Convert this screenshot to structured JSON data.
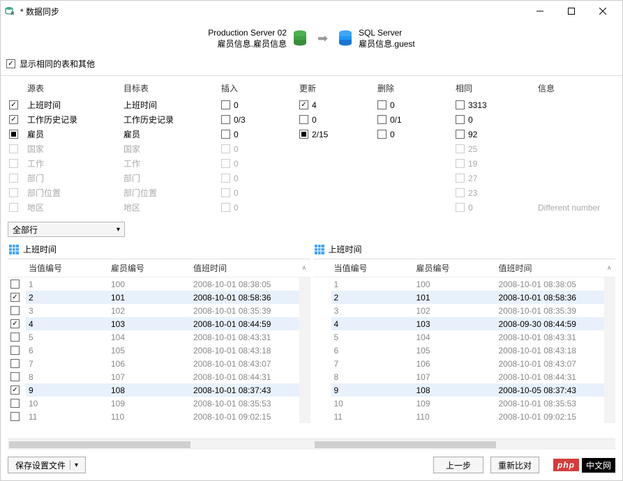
{
  "window": {
    "title": "* 数据同步"
  },
  "connection": {
    "source": {
      "server": "Production Server 02",
      "db": "雇员信息.雇员信息"
    },
    "target": {
      "server": "SQL Server",
      "db": "雇员信息.guest"
    }
  },
  "options": {
    "show_identical": "显示相同的表和其他"
  },
  "tables": {
    "headers": {
      "source": "源表",
      "target": "目标表",
      "insert": "插入",
      "update": "更新",
      "delete": "删除",
      "same": "相同",
      "info": "信息"
    },
    "rows": [
      {
        "check": "checked",
        "src": "上班时间",
        "tgt": "上班时间",
        "ins": "0",
        "upd": "4",
        "upd_check": "checked",
        "del": "0",
        "same": "3313",
        "info": "",
        "dis": false
      },
      {
        "check": "checked",
        "src": "工作历史记录",
        "tgt": "工作历史记录",
        "ins": "0/3",
        "upd": "0",
        "del": "0/1",
        "same": "0",
        "info": "",
        "dis": false
      },
      {
        "check": "partial",
        "src": "雇员",
        "tgt": "雇员",
        "ins": "0",
        "upd": "2/15",
        "upd_check": "partial",
        "del": "0",
        "same": "92",
        "info": "",
        "dis": false
      },
      {
        "check": "",
        "src": "国家",
        "tgt": "国家",
        "ins": "0",
        "upd": "",
        "del": "",
        "same": "25",
        "info": "",
        "dis": true
      },
      {
        "check": "",
        "src": "工作",
        "tgt": "工作",
        "ins": "0",
        "upd": "",
        "del": "",
        "same": "19",
        "info": "",
        "dis": true
      },
      {
        "check": "",
        "src": "部门",
        "tgt": "部门",
        "ins": "0",
        "upd": "",
        "del": "",
        "same": "27",
        "info": "",
        "dis": true
      },
      {
        "check": "",
        "src": "部门位置",
        "tgt": "部门位置",
        "ins": "0",
        "upd": "",
        "del": "",
        "same": "23",
        "info": "",
        "dis": true
      },
      {
        "check": "",
        "src": "地区",
        "tgt": "地区",
        "ins": "0",
        "upd": "",
        "del": "",
        "same": "0",
        "info": "Different number",
        "dis": true
      }
    ]
  },
  "filter": {
    "label": "全部行"
  },
  "panes": {
    "left": {
      "title": "上班时间",
      "columns": [
        "当值编号",
        "雇员编号",
        "值班时间"
      ],
      "rows": [
        {
          "c": "",
          "v": [
            "1",
            "100",
            "2008-10-01 08:38:05"
          ],
          "hl": false
        },
        {
          "c": "checked",
          "v": [
            "2",
            "101",
            "2008-10-01 08:58:36"
          ],
          "hl": true
        },
        {
          "c": "",
          "v": [
            "3",
            "102",
            "2008-10-01 08:35:39"
          ],
          "hl": false
        },
        {
          "c": "checked",
          "v": [
            "4",
            "103",
            "2008-10-01 08:44:59"
          ],
          "hl": true
        },
        {
          "c": "",
          "v": [
            "5",
            "104",
            "2008-10-01 08:43:31"
          ],
          "hl": false
        },
        {
          "c": "",
          "v": [
            "6",
            "105",
            "2008-10-01 08:43:18"
          ],
          "hl": false
        },
        {
          "c": "",
          "v": [
            "7",
            "106",
            "2008-10-01 08:43:07"
          ],
          "hl": false
        },
        {
          "c": "",
          "v": [
            "8",
            "107",
            "2008-10-01 08:44:31"
          ],
          "hl": false
        },
        {
          "c": "checked",
          "v": [
            "9",
            "108",
            "2008-10-01 08:37:43"
          ],
          "hl": true
        },
        {
          "c": "",
          "v": [
            "10",
            "109",
            "2008-10-01 08:35:53"
          ],
          "hl": false
        },
        {
          "c": "",
          "v": [
            "11",
            "110",
            "2008-10-01 09:02:15"
          ],
          "hl": false
        }
      ]
    },
    "right": {
      "title": "上班时间",
      "columns": [
        "当值编号",
        "雇员编号",
        "值班时间"
      ],
      "rows": [
        {
          "c": "",
          "v": [
            "1",
            "100",
            "2008-10-01 08:38:05"
          ],
          "hl": false
        },
        {
          "c": "",
          "v": [
            "2",
            "101",
            "2008-10-01 08:58:36"
          ],
          "hl": true
        },
        {
          "c": "",
          "v": [
            "3",
            "102",
            "2008-10-01 08:35:39"
          ],
          "hl": false
        },
        {
          "c": "",
          "v": [
            "4",
            "103",
            "2008-09-30 08:44:59"
          ],
          "hl": true
        },
        {
          "c": "",
          "v": [
            "5",
            "104",
            "2008-10-01 08:43:31"
          ],
          "hl": false
        },
        {
          "c": "",
          "v": [
            "6",
            "105",
            "2008-10-01 08:43:18"
          ],
          "hl": false
        },
        {
          "c": "",
          "v": [
            "7",
            "106",
            "2008-10-01 08:43:07"
          ],
          "hl": false
        },
        {
          "c": "",
          "v": [
            "8",
            "107",
            "2008-10-01 08:44:31"
          ],
          "hl": false
        },
        {
          "c": "",
          "v": [
            "9",
            "108",
            "2008-10-05 08:37:43"
          ],
          "hl": true
        },
        {
          "c": "",
          "v": [
            "10",
            "109",
            "2008-10-01 08:35:53"
          ],
          "hl": false
        },
        {
          "c": "",
          "v": [
            "11",
            "110",
            "2008-10-01 09:02:15"
          ],
          "hl": false
        }
      ]
    }
  },
  "buttons": {
    "save_profile": "保存设置文件",
    "prev": "上一步",
    "recompare": "重新比对"
  },
  "badge": {
    "left": "php",
    "right": "中文网"
  }
}
